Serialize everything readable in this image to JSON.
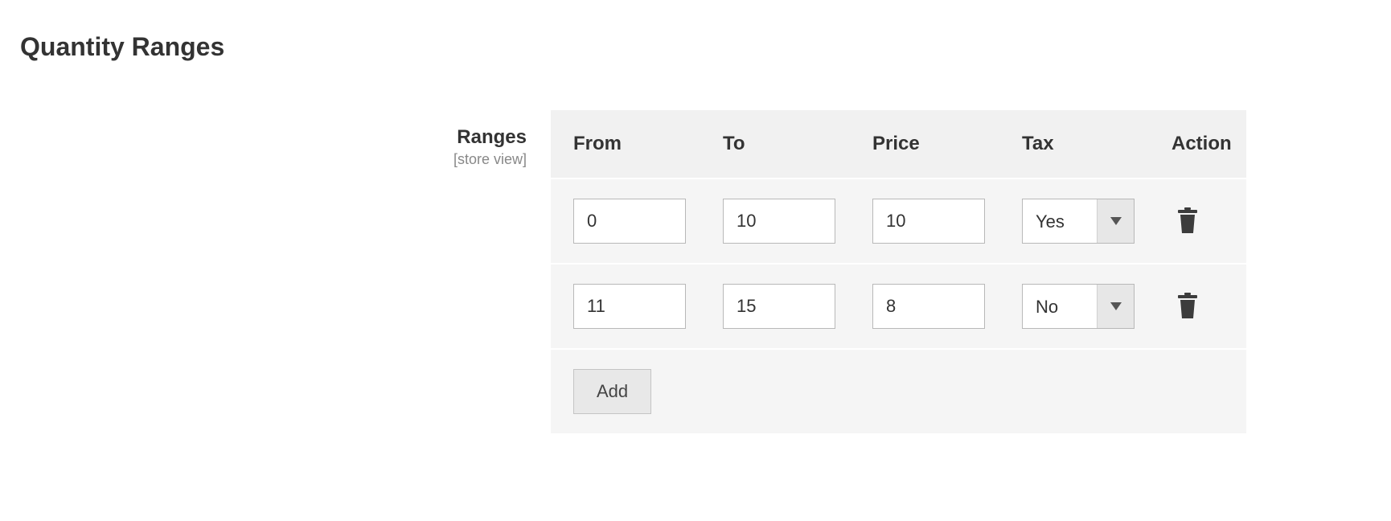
{
  "section": {
    "title": "Quantity Ranges"
  },
  "field": {
    "label": "Ranges",
    "scope": "[store view]"
  },
  "columns": {
    "from": "From",
    "to": "To",
    "price": "Price",
    "tax": "Tax",
    "action": "Action"
  },
  "rows": [
    {
      "from": "0",
      "to": "10",
      "price": "10",
      "tax": "Yes"
    },
    {
      "from": "11",
      "to": "15",
      "price": "8",
      "tax": "No"
    }
  ],
  "tax_options": [
    "Yes",
    "No"
  ],
  "buttons": {
    "add": "Add"
  },
  "icons": {
    "trash": "trash-icon",
    "chevron": "chevron-down-icon"
  }
}
